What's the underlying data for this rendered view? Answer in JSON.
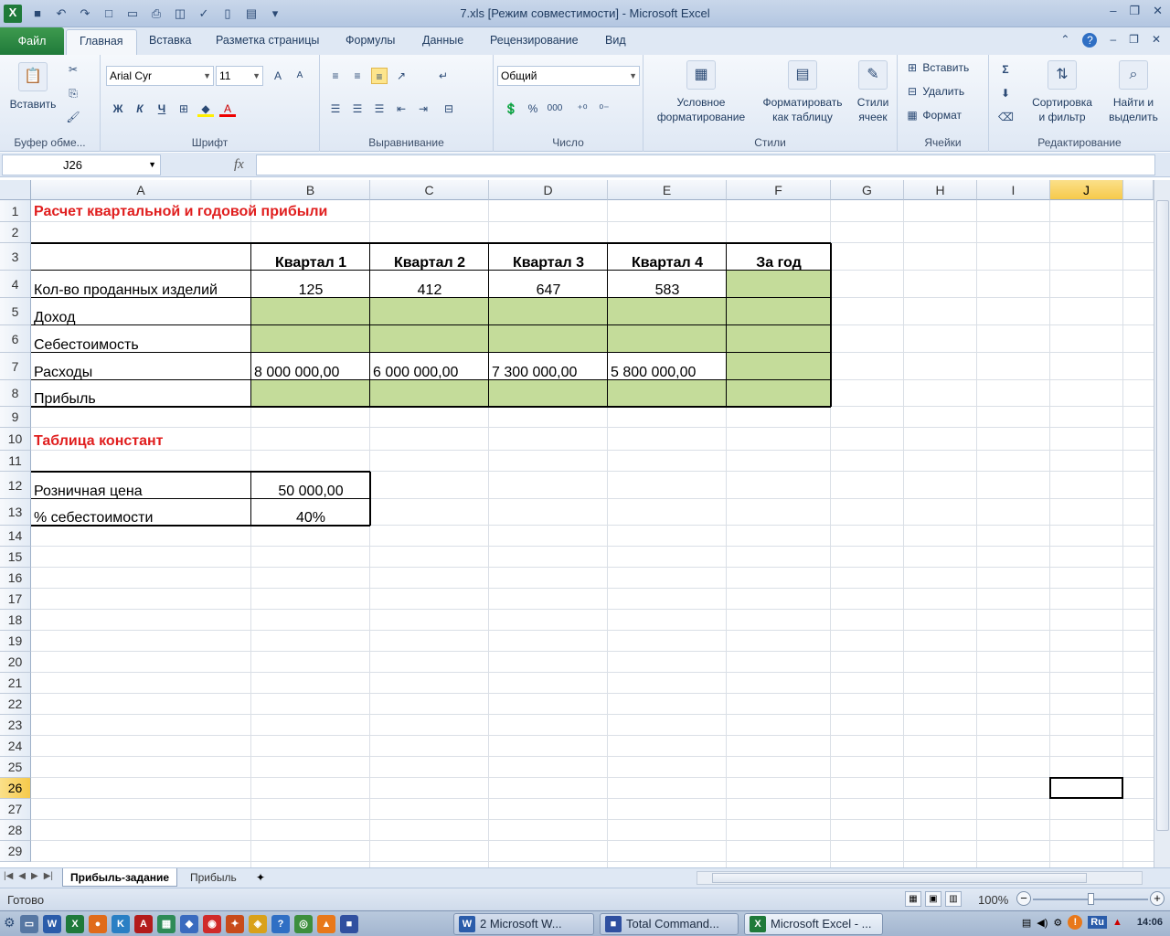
{
  "window": {
    "title": "7.xls  [Режим совместимости]  -  Microsoft Excel"
  },
  "ribbon_tabs": {
    "file": "Файл",
    "tabs": [
      "Главная",
      "Вставка",
      "Разметка страницы",
      "Формулы",
      "Данные",
      "Рецензирование",
      "Вид"
    ]
  },
  "ribbon": {
    "clipboard": {
      "paste": "Вставить",
      "group": "Буфер обме..."
    },
    "font": {
      "name": "Arial Cyr",
      "size": "11",
      "bold": "Ж",
      "italic": "К",
      "underline": "Ч",
      "group": "Шрифт"
    },
    "alignment": {
      "group": "Выравнивание"
    },
    "number": {
      "format": "Общий",
      "percent": "%",
      "thousands": "000",
      "group": "Число"
    },
    "styles": {
      "conditional_1": "Условное",
      "conditional_2": "форматирование",
      "table_1": "Форматировать",
      "table_2": "как таблицу",
      "cell_1": "Стили",
      "cell_2": "ячеек",
      "group": "Стили"
    },
    "cells": {
      "insert": "Вставить",
      "delete": "Удалить",
      "format": "Формат",
      "group": "Ячейки"
    },
    "editing": {
      "sort_1": "Сортировка",
      "sort_2": "и фильтр",
      "find_1": "Найти и",
      "find_2": "выделить",
      "group": "Редактирование"
    }
  },
  "formula_bar": {
    "name_box": "J26",
    "fx": "fx",
    "formula": ""
  },
  "grid": {
    "columns": [
      "A",
      "B",
      "C",
      "D",
      "E",
      "F",
      "G",
      "H",
      "I",
      "J"
    ],
    "rows": [
      "1",
      "2",
      "3",
      "4",
      "5",
      "6",
      "7",
      "8",
      "9",
      "10",
      "11",
      "12",
      "13",
      "14",
      "15",
      "16",
      "17",
      "18",
      "19",
      "20",
      "21",
      "22",
      "23",
      "24",
      "25",
      "26",
      "27",
      "28",
      "29"
    ],
    "selected_column": "J",
    "selected_row": "26"
  },
  "sheet": {
    "title": "Расчет квартальной и годовой прибыли",
    "headers": [
      "Квартал 1",
      "Квартал 2",
      "Квартал 3",
      "Квартал 4",
      "За год"
    ],
    "row4_label": "Кол-во проданных изделий",
    "row4_values": [
      "125",
      "412",
      "647",
      "583"
    ],
    "row5_label": "Доход",
    "row6_label": "Себестоимость",
    "row7_label": "Расходы",
    "row7_values": [
      "8 000 000,00",
      "6 000 000,00",
      "7 300 000,00",
      "5 800 000,00"
    ],
    "row8_label": "Прибыль",
    "constants_title": "Таблица констант",
    "retail_label": "Розничная цена",
    "retail_value": "50 000,00",
    "cost_label": "% себестоимости",
    "cost_value": "40%"
  },
  "sheet_tabs": [
    "Прибыль-задание",
    "Прибыль"
  ],
  "status": {
    "ready": "Готово",
    "zoom": "100%"
  },
  "taskbar": {
    "tasks": [
      "2 Microsoft W...",
      "Total Command...",
      "Microsoft Excel - ..."
    ],
    "lang": "Ru",
    "clock": "14:06"
  },
  "colors": {
    "green_fill": "#c4dc9a",
    "title_red": "#e01e1e",
    "selection": "#f6c94a"
  }
}
